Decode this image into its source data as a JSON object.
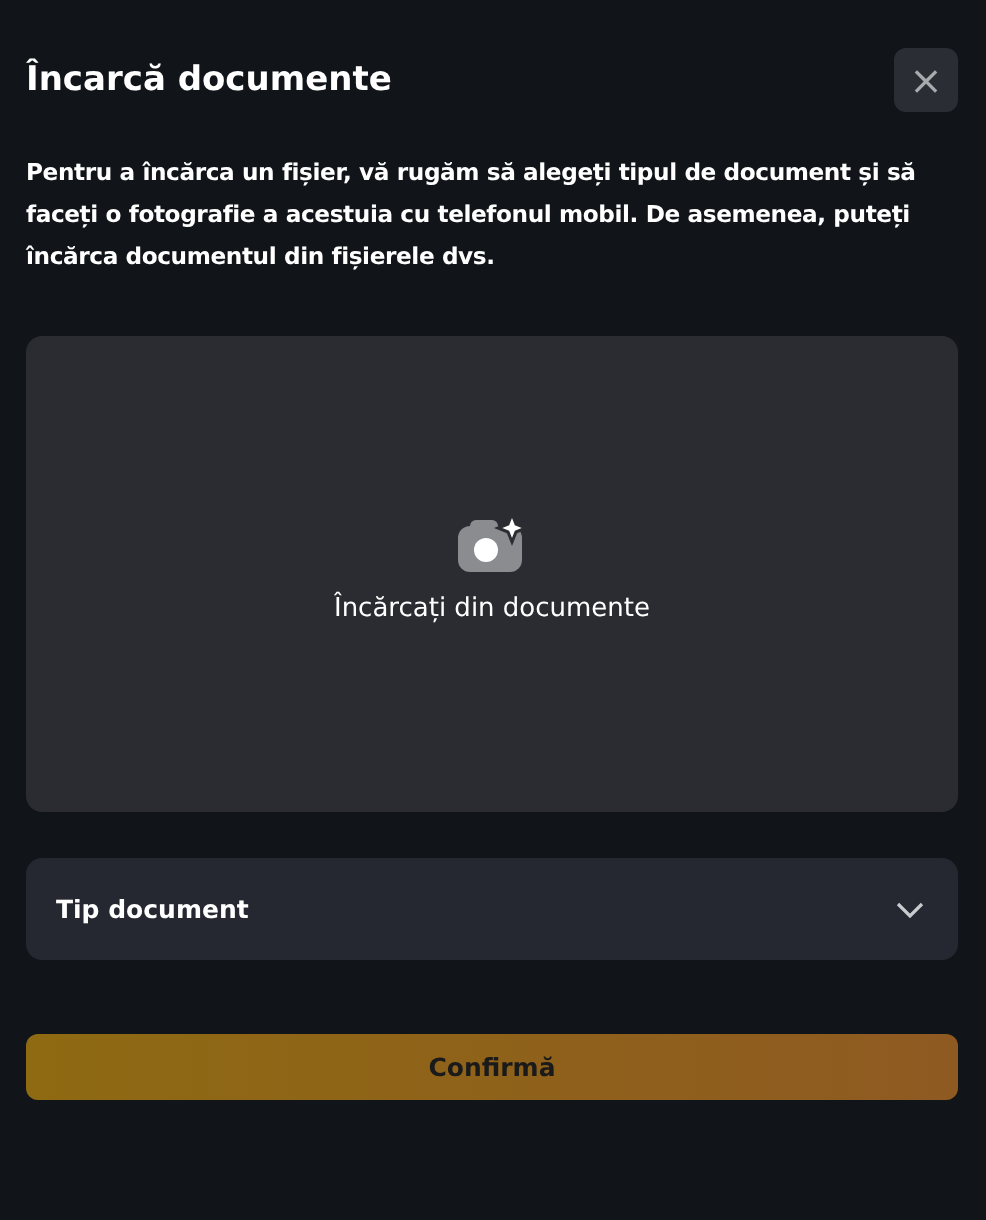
{
  "dialog": {
    "title": "Încarcă documente",
    "close": "×",
    "description": "Pentru a încărca un fișier, vă rugăm să alegeți tipul de document și să faceți o fotografie a acestuia cu telefonul mobil. De asemenea, puteți încărca documentul din fișierele dvs."
  },
  "upload": {
    "label": "Încărcați din documente"
  },
  "document_type": {
    "placeholder": "Tip document",
    "expanded": false
  },
  "confirm": {
    "label": "Confirmă",
    "disabled": true
  }
}
